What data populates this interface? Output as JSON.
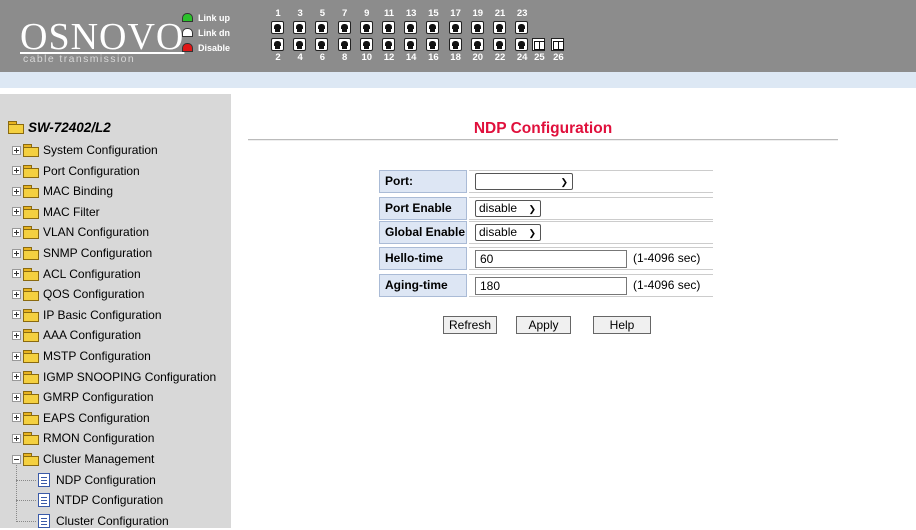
{
  "header": {
    "logo": {
      "title": "OSNOVO",
      "subtitle": "cable transmission"
    },
    "legend": [
      {
        "label": "Link up",
        "color": "#2ac22a"
      },
      {
        "label": "Link dn",
        "color": "#ffffff"
      },
      {
        "label": "Disable",
        "color": "#e01616"
      }
    ],
    "ports_top": [
      "1",
      "3",
      "5",
      "7",
      "9",
      "11",
      "13",
      "15",
      "17",
      "19",
      "21",
      "23"
    ],
    "ports_bottom": [
      "2",
      "4",
      "6",
      "8",
      "10",
      "12",
      "14",
      "16",
      "18",
      "20",
      "22",
      "24",
      "25",
      "26"
    ]
  },
  "sidebar": {
    "root": "SW-72402/L2",
    "items": [
      "System Configuration",
      "Port Configuration",
      "MAC Binding",
      "MAC Filter",
      "VLAN Configuration",
      "SNMP Configuration",
      "ACL Configuration",
      "QOS Configuration",
      "IP Basic Configuration",
      "AAA Configuration",
      "MSTP Configuration",
      "IGMP SNOOPING Configuration",
      "GMRP Configuration",
      "EAPS Configuration",
      "RMON Configuration",
      "Cluster Management"
    ],
    "children": [
      "NDP Configuration",
      "NTDP Configuration",
      "Cluster Configuration"
    ]
  },
  "main": {
    "title": "NDP Configuration",
    "form": {
      "port": {
        "label": "Port:",
        "value": ""
      },
      "port_enable": {
        "label": "Port Enable",
        "value": "disable"
      },
      "global_enable": {
        "label": "Global Enable",
        "value": "disable"
      },
      "hello_time": {
        "label": "Hello-time",
        "value": "60",
        "hint": "(1-4096 sec)"
      },
      "aging_time": {
        "label": "Aging-time",
        "value": "180",
        "hint": "(1-4096 sec)"
      }
    },
    "buttons": {
      "refresh": "Refresh",
      "apply": "Apply",
      "help": "Help"
    }
  }
}
